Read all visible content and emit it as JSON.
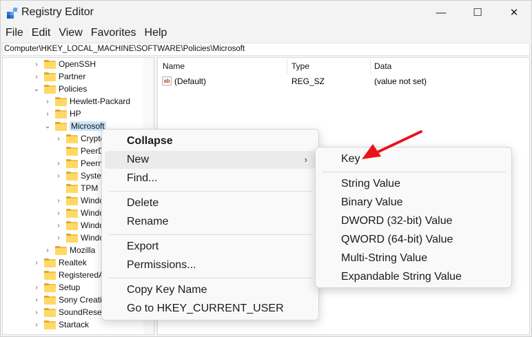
{
  "window": {
    "title": "Registry Editor",
    "minimize_glyph": "—",
    "maximize_glyph": "☐",
    "close_glyph": "✕"
  },
  "menubar": [
    "File",
    "Edit",
    "View",
    "Favorites",
    "Help"
  ],
  "address": "Computer\\HKEY_LOCAL_MACHINE\\SOFTWARE\\Policies\\Microsoft",
  "tree": {
    "items": [
      {
        "label": "OpenSSH",
        "chevron": "›"
      },
      {
        "label": "Partner",
        "chevron": "›"
      },
      {
        "label": "Policies",
        "chevron": "⌄"
      },
      {
        "label": "Hewlett-Packard",
        "chevron": "›"
      },
      {
        "label": "HP",
        "chevron": "›"
      },
      {
        "label": "Microsoft",
        "chevron": "⌄"
      },
      {
        "label": "Crypto",
        "chevron": "›"
      },
      {
        "label": "PeerD",
        "chevron": ""
      },
      {
        "label": "Peern",
        "chevron": "›"
      },
      {
        "label": "Syster",
        "chevron": "›"
      },
      {
        "label": "TPM",
        "chevron": ""
      },
      {
        "label": "Windo",
        "chevron": "›"
      },
      {
        "label": "Windo",
        "chevron": "›"
      },
      {
        "label": "Windo",
        "chevron": "›"
      },
      {
        "label": "Windo",
        "chevron": "›"
      },
      {
        "label": "Mozilla",
        "chevron": "›"
      },
      {
        "label": "Realtek",
        "chevron": "›"
      },
      {
        "label": "RegisteredA",
        "chevron": ""
      },
      {
        "label": "Setup",
        "chevron": "›"
      },
      {
        "label": "Sony Creativ",
        "chevron": "›"
      },
      {
        "label": "SoundResea",
        "chevron": "›"
      },
      {
        "label": "Startack",
        "chevron": "›"
      }
    ]
  },
  "list": {
    "columns": [
      "Name",
      "Type",
      "Data"
    ],
    "rows": [
      {
        "icon_text": "ab",
        "name": "(Default)",
        "type": "REG_SZ",
        "data": "(value not set)"
      }
    ]
  },
  "context_menu": {
    "items": [
      "Collapse",
      "New",
      "Find...",
      "Delete",
      "Rename",
      "Export",
      "Permissions...",
      "Copy Key Name",
      "Go to HKEY_CURRENT_USER"
    ],
    "submenu_arrow": "›"
  },
  "submenu": {
    "items": [
      "Key",
      "String Value",
      "Binary Value",
      "DWORD (32-bit) Value",
      "QWORD (64-bit) Value",
      "Multi-String Value",
      "Expandable String Value"
    ]
  },
  "colors": {
    "annotation_arrow": "#e8141c",
    "selection": "#cce4f7",
    "folder": "#ffd966"
  },
  "icons": {
    "app": "registry-editor-icon",
    "folder": "folder-icon",
    "string_value": "string-value-icon",
    "annotation": "red-arrow-icon"
  }
}
